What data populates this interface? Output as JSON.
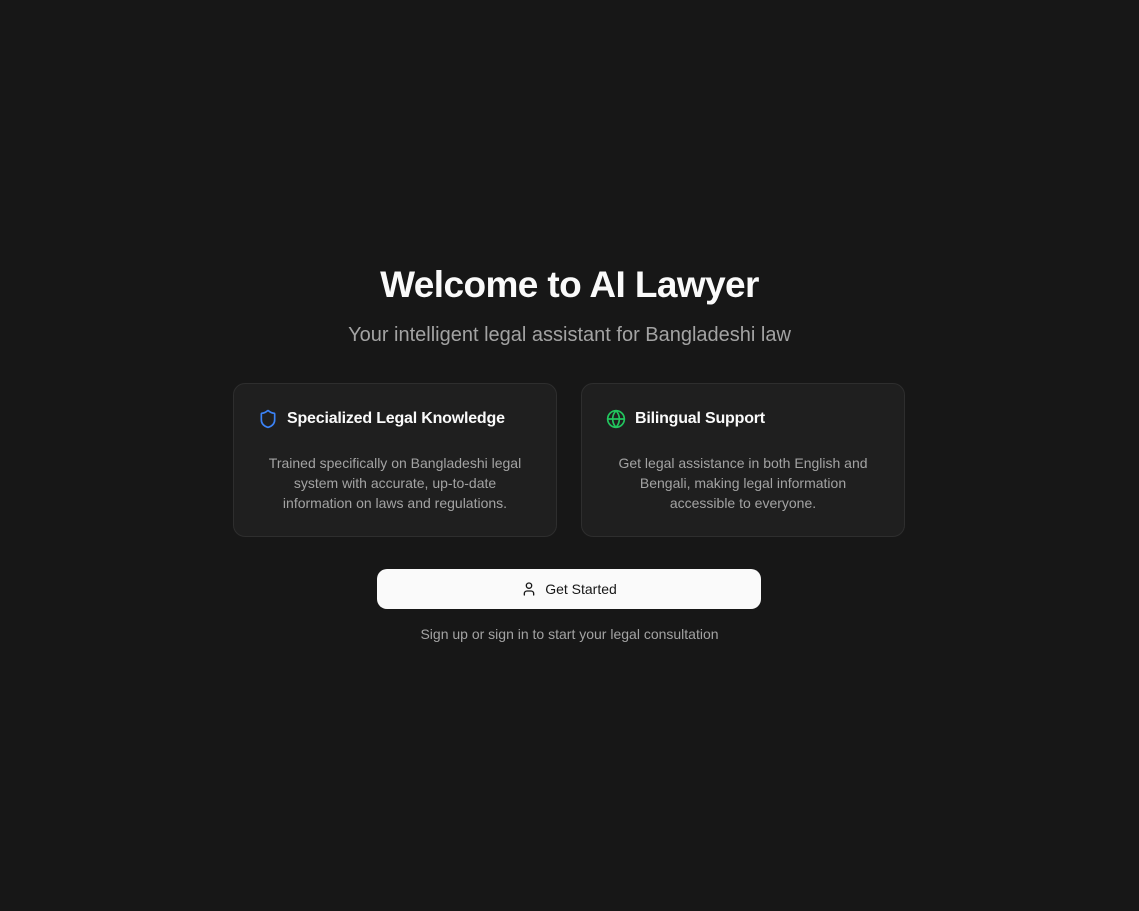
{
  "hero": {
    "title": "Welcome to AI Lawyer",
    "subtitle": "Your intelligent legal assistant for Bangladeshi law"
  },
  "features": [
    {
      "icon": "shield-icon",
      "icon_color": "#3b82f6",
      "title": "Specialized Legal Knowledge",
      "description": "Trained specifically on Bangladeshi legal system with accurate, up-to-date information on laws and regulations."
    },
    {
      "icon": "globe-icon",
      "icon_color": "#22c55e",
      "title": "Bilingual Support",
      "description": "Get legal assistance in both English and Bengali, making legal information accessible to everyone."
    }
  ],
  "cta": {
    "icon": "user-icon",
    "label": "Get Started"
  },
  "hint": "Sign up or sign in to start your legal consultation",
  "colors": {
    "background": "#171717",
    "card_background": "#1f1f1f",
    "card_border": "#2e2e2e",
    "primary_text": "#fafafa",
    "muted_text": "#a3a3a3",
    "button_background": "#fafafa",
    "button_text": "#171717"
  }
}
